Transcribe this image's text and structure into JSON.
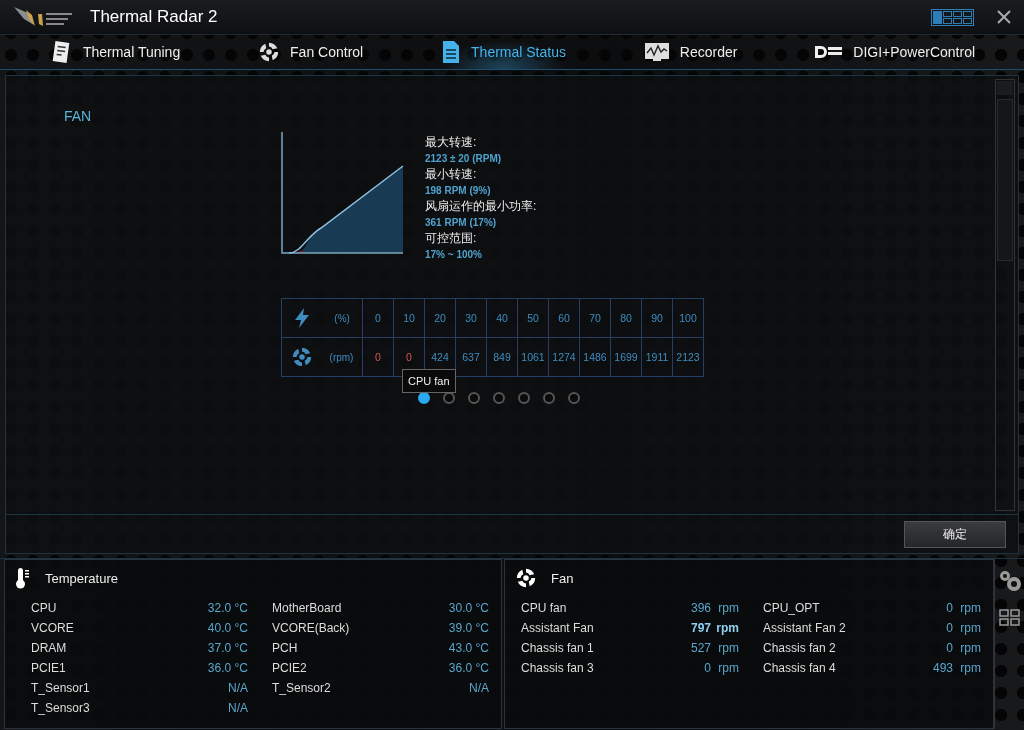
{
  "window": {
    "title": "Thermal Radar 2"
  },
  "tabs": [
    {
      "label": "Thermal Tuning",
      "selected": false
    },
    {
      "label": "Fan Control",
      "selected": false
    },
    {
      "label": "Thermal Status",
      "selected": true
    },
    {
      "label": "Recorder",
      "selected": false
    },
    {
      "label": "DIGI+PowerControl",
      "selected": false
    }
  ],
  "fan_panel": {
    "heading": "FAN",
    "info": [
      {
        "label": "最大转速:",
        "value": "2123 ± 20 (RPM)"
      },
      {
        "label": "最小转速:",
        "value": "198 RPM (9%)"
      },
      {
        "label": "风扇运作的最小功率:",
        "value": "361 RPM (17%)"
      },
      {
        "label": "可控范围:",
        "value": "17% ~ 100%"
      }
    ],
    "table": {
      "percent_unit": "(%)",
      "rpm_unit": "(rpm)",
      "percent": [
        "0",
        "10",
        "20",
        "30",
        "40",
        "50",
        "60",
        "70",
        "80",
        "90",
        "100"
      ],
      "rpm": [
        {
          "value": "0",
          "stopped": true
        },
        {
          "value": "0",
          "stopped": true
        },
        {
          "value": "424",
          "stopped": false
        },
        {
          "value": "637",
          "stopped": false
        },
        {
          "value": "849",
          "stopped": false
        },
        {
          "value": "1061",
          "stopped": false
        },
        {
          "value": "1274",
          "stopped": false
        },
        {
          "value": "1486",
          "stopped": false
        },
        {
          "value": "1699",
          "stopped": false
        },
        {
          "value": "1911",
          "stopped": false
        },
        {
          "value": "2123",
          "stopped": false
        }
      ]
    },
    "tooltip": "CPU fan",
    "pages": [
      {
        "selected": true
      },
      {
        "selected": false
      },
      {
        "selected": false
      },
      {
        "selected": false
      },
      {
        "selected": false
      },
      {
        "selected": false
      },
      {
        "selected": false
      }
    ]
  },
  "ok_button": "确定",
  "temperature": {
    "title": "Temperature",
    "columns": [
      [
        {
          "name": "CPU",
          "value": "32.0 °C"
        },
        {
          "name": "VCORE",
          "value": "40.0 °C"
        },
        {
          "name": "DRAM",
          "value": "37.0 °C"
        },
        {
          "name": "PCIE1",
          "value": "36.0 °C"
        },
        {
          "name": "T_Sensor1",
          "value": "N/A"
        },
        {
          "name": "T_Sensor3",
          "value": "N/A"
        }
      ],
      [
        {
          "name": "MotherBoard",
          "value": "30.0 °C"
        },
        {
          "name": "VCORE(Back)",
          "value": "39.0 °C"
        },
        {
          "name": "PCH",
          "value": "43.0 °C"
        },
        {
          "name": "PCIE2",
          "value": "36.0 °C"
        },
        {
          "name": "T_Sensor2",
          "value": "N/A"
        }
      ]
    ]
  },
  "fan": {
    "title": "Fan",
    "columns": [
      [
        {
          "name": "CPU fan",
          "value": "396",
          "unit": "rpm",
          "highlighted": false
        },
        {
          "name": "Assistant Fan",
          "value": "797",
          "unit": "rpm",
          "highlighted": true
        },
        {
          "name": "Chassis fan 1",
          "value": "527",
          "unit": "rpm",
          "highlighted": false
        },
        {
          "name": "Chassis fan 3",
          "value": "0",
          "unit": "rpm",
          "highlighted": false
        }
      ],
      [
        {
          "name": "CPU_OPT",
          "value": "0",
          "unit": "rpm",
          "highlighted": false
        },
        {
          "name": "Assistant Fan 2",
          "value": "0",
          "unit": "rpm",
          "highlighted": false
        },
        {
          "name": "Chassis fan 2",
          "value": "0",
          "unit": "rpm",
          "highlighted": false
        },
        {
          "name": "Chassis fan 4",
          "value": "493",
          "unit": "rpm",
          "highlighted": false
        }
      ]
    ]
  }
}
